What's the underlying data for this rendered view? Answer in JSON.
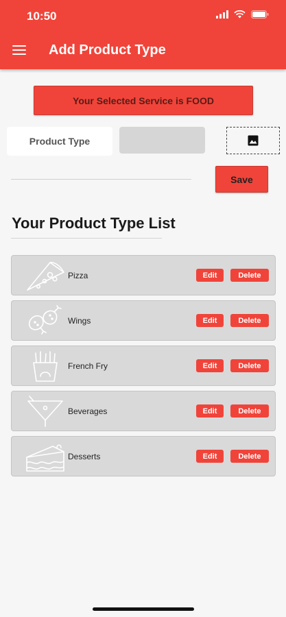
{
  "status_bar": {
    "time": "10:50"
  },
  "app_bar": {
    "title": "Add Product Type"
  },
  "banner": {
    "text": "Your Selected Service is FOOD"
  },
  "form": {
    "product_type_label": "Product Type",
    "product_type_value": "",
    "save_label": "Save"
  },
  "list": {
    "title": "Your Product Type List",
    "items": [
      {
        "name": "Pizza",
        "icon": "pizza-icon",
        "edit_label": "Edit",
        "delete_label": "Delete"
      },
      {
        "name": "Wings",
        "icon": "wings-icon",
        "edit_label": "Edit",
        "delete_label": "Delete"
      },
      {
        "name": "French Fry",
        "icon": "fries-icon",
        "edit_label": "Edit",
        "delete_label": "Delete"
      },
      {
        "name": "Beverages",
        "icon": "cocktail-icon",
        "edit_label": "Edit",
        "delete_label": "Delete"
      },
      {
        "name": "Desserts",
        "icon": "cake-icon",
        "edit_label": "Edit",
        "delete_label": "Delete"
      }
    ]
  },
  "colors": {
    "accent": "#f0443a",
    "card": "#d9d9d9",
    "background": "#f6f6f6"
  }
}
